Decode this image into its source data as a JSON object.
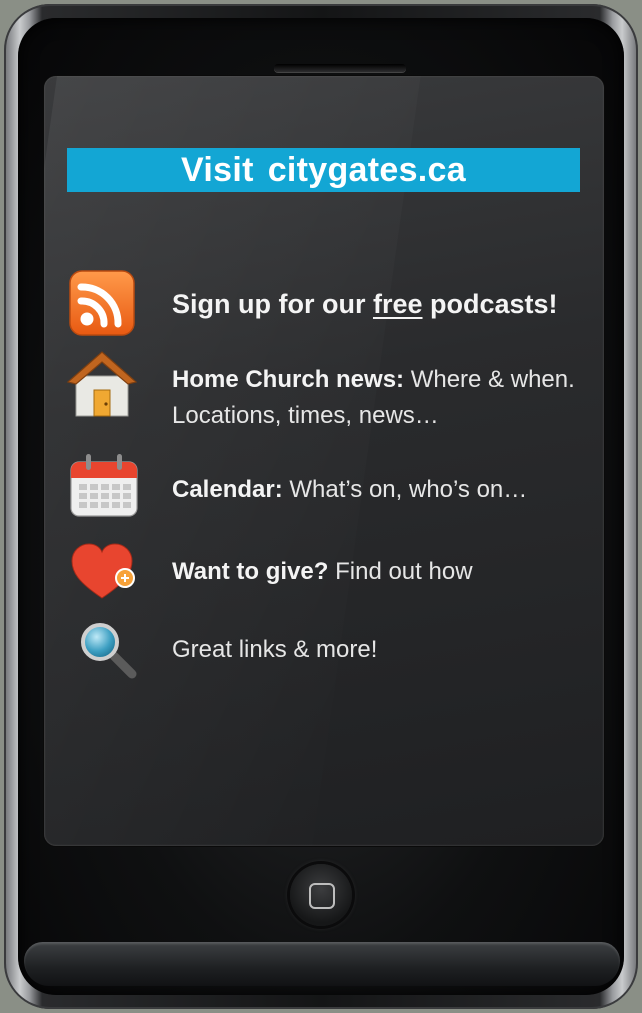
{
  "banner": {
    "visit": "Visit",
    "site": "citygates.ca"
  },
  "items": [
    {
      "icon": "rss-icon",
      "pre": "Sign up for our ",
      "underlined": "free",
      "post": " podcasts!"
    },
    {
      "icon": "home-icon",
      "bold": "Home Church news:",
      "text": " Where & when.",
      "line2": "Locations, times, news…"
    },
    {
      "icon": "calendar-icon",
      "bold": "Calendar:",
      "text": " What’s on, who’s on…"
    },
    {
      "icon": "heart-icon",
      "bold": "Want to give?",
      "text": " Find out how"
    },
    {
      "icon": "magnifier-icon",
      "text": "Great links & more!"
    }
  ],
  "colors": {
    "banner": "#13a6d4",
    "rss": "#f26a21",
    "house_roof": "#c0651f",
    "heart": "#e8452f"
  }
}
